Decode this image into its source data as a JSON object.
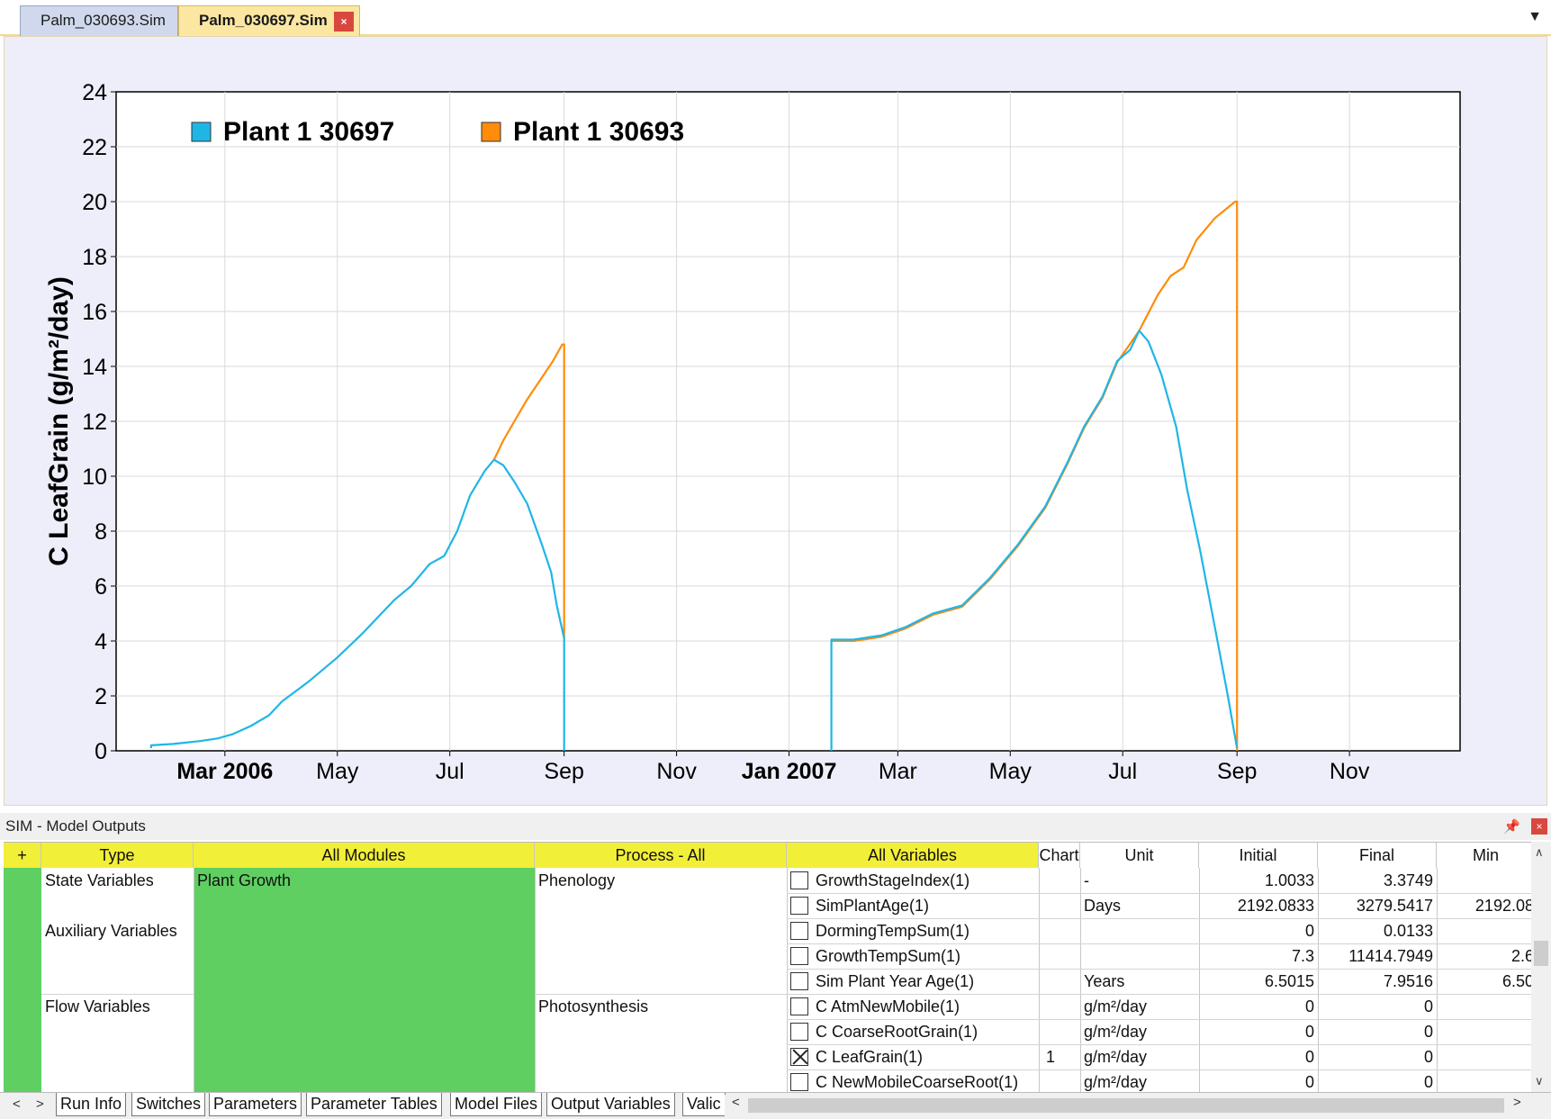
{
  "doc_tabs": {
    "inactive": "Palm_030693.Sim",
    "active": "Palm_030697.Sim",
    "close_glyph": "×",
    "dropdown_glyph": "▼"
  },
  "chart_data": {
    "type": "line",
    "ylabel": "C LeafGrain (g/m²/day)",
    "ylim": [
      0,
      24
    ],
    "yticks": [
      0,
      2,
      4,
      6,
      8,
      10,
      12,
      14,
      16,
      18,
      20,
      22,
      24
    ],
    "xticks": [
      {
        "label": "Mar 2006",
        "date": "2006-03-01",
        "bold": true
      },
      {
        "label": "May",
        "date": "2006-05-01",
        "bold": false
      },
      {
        "label": "Jul",
        "date": "2006-07-01",
        "bold": false
      },
      {
        "label": "Sep",
        "date": "2006-09-01",
        "bold": false
      },
      {
        "label": "Nov",
        "date": "2006-11-01",
        "bold": false
      },
      {
        "label": "Jan 2007",
        "date": "2007-01-01",
        "bold": true
      },
      {
        "label": "Mar",
        "date": "2007-03-01",
        "bold": false
      },
      {
        "label": "May",
        "date": "2007-05-01",
        "bold": false
      },
      {
        "label": "Jul",
        "date": "2007-07-01",
        "bold": false
      },
      {
        "label": "Sep",
        "date": "2007-09-01",
        "bold": false
      },
      {
        "label": "Nov",
        "date": "2007-11-01",
        "bold": false
      }
    ],
    "xlim": [
      "2006-01-01",
      "2007-12-31"
    ],
    "grid": true,
    "legend_placement": "top-left",
    "series": [
      {
        "name": "Plant 1 30697",
        "color": "#1fb6e6",
        "segments": [
          [
            [
              "2006-01-20",
              0.1
            ],
            [
              "2006-01-20",
              0.2
            ],
            [
              "2006-02-01",
              0.25
            ],
            [
              "2006-02-15",
              0.35
            ],
            [
              "2006-02-25",
              0.45
            ],
            [
              "2006-03-05",
              0.6
            ],
            [
              "2006-03-15",
              0.9
            ],
            [
              "2006-03-25",
              1.3
            ],
            [
              "2006-04-01",
              1.8
            ],
            [
              "2006-04-15",
              2.5
            ],
            [
              "2006-05-01",
              3.4
            ],
            [
              "2006-05-15",
              4.3
            ],
            [
              "2006-06-01",
              5.5
            ],
            [
              "2006-06-10",
              6.0
            ],
            [
              "2006-06-20",
              6.8
            ],
            [
              "2006-06-28",
              7.1
            ],
            [
              "2006-07-05",
              8.0
            ],
            [
              "2006-07-12",
              9.3
            ],
            [
              "2006-07-20",
              10.2
            ],
            [
              "2006-07-25",
              10.6
            ],
            [
              "2006-07-30",
              10.4
            ],
            [
              "2006-08-05",
              9.8
            ],
            [
              "2006-08-12",
              9.0
            ],
            [
              "2006-08-20",
              7.5
            ],
            [
              "2006-08-25",
              6.5
            ],
            [
              "2006-08-28",
              5.3
            ],
            [
              "2006-09-01",
              4.1
            ],
            [
              "2006-09-01",
              0.0
            ]
          ],
          [
            [
              "2007-01-24",
              0.0
            ],
            [
              "2007-01-24",
              4.05
            ],
            [
              "2007-02-05",
              4.05
            ],
            [
              "2007-02-20",
              4.2
            ],
            [
              "2007-03-05",
              4.5
            ],
            [
              "2007-03-20",
              5.0
            ],
            [
              "2007-04-05",
              5.3
            ],
            [
              "2007-04-20",
              6.3
            ],
            [
              "2007-05-05",
              7.5
            ],
            [
              "2007-05-20",
              8.9
            ],
            [
              "2007-06-01",
              10.5
            ],
            [
              "2007-06-10",
              11.8
            ],
            [
              "2007-06-20",
              12.9
            ],
            [
              "2007-06-28",
              14.2
            ],
            [
              "2007-07-05",
              14.6
            ],
            [
              "2007-07-10",
              15.3
            ],
            [
              "2007-07-15",
              14.9
            ],
            [
              "2007-07-22",
              13.7
            ],
            [
              "2007-07-30",
              11.8
            ],
            [
              "2007-08-05",
              9.5
            ],
            [
              "2007-08-12",
              7.3
            ],
            [
              "2007-08-20",
              4.5
            ],
            [
              "2007-08-27",
              2.0
            ],
            [
              "2007-09-01",
              0.1
            ]
          ]
        ]
      },
      {
        "name": "Plant 1 30693",
        "color": "#ff8c0a",
        "segments": [
          [
            [
              "2006-07-25",
              10.6
            ],
            [
              "2006-07-30",
              11.3
            ],
            [
              "2006-08-05",
              12.0
            ],
            [
              "2006-08-12",
              12.8
            ],
            [
              "2006-08-20",
              13.6
            ],
            [
              "2006-08-26",
              14.2
            ],
            [
              "2006-08-31",
              14.8
            ],
            [
              "2006-09-01",
              14.8
            ],
            [
              "2006-09-01",
              4.1
            ]
          ],
          [
            [
              "2007-01-24",
              4.0
            ],
            [
              "2007-02-05",
              4.0
            ],
            [
              "2007-02-20",
              4.15
            ],
            [
              "2007-03-05",
              4.45
            ],
            [
              "2007-03-20",
              4.95
            ],
            [
              "2007-04-05",
              5.25
            ],
            [
              "2007-04-20",
              6.25
            ],
            [
              "2007-05-05",
              7.45
            ],
            [
              "2007-05-20",
              8.85
            ],
            [
              "2007-06-01",
              10.45
            ],
            [
              "2007-06-10",
              11.75
            ],
            [
              "2007-06-20",
              12.85
            ],
            [
              "2007-06-28",
              14.15
            ],
            [
              "2007-07-10",
              15.3
            ],
            [
              "2007-07-20",
              16.6
            ],
            [
              "2007-07-27",
              17.3
            ],
            [
              "2007-08-03",
              17.6
            ],
            [
              "2007-08-10",
              18.6
            ],
            [
              "2007-08-20",
              19.4
            ],
            [
              "2007-08-31",
              20.0
            ],
            [
              "2007-09-01",
              20.0
            ],
            [
              "2007-09-01",
              0.0
            ]
          ]
        ]
      }
    ]
  },
  "outputs": {
    "title": "SIM - Model Outputs",
    "pin_glyph": "📌",
    "close_glyph": "×",
    "headers": {
      "plus": "+",
      "type": "Type",
      "modules": "All Modules",
      "process": "Process - All",
      "variables": "All Variables",
      "chart": "Chart",
      "unit": "Unit",
      "initial": "Initial",
      "final": "Final",
      "min": "Min"
    },
    "types": [
      "State Variables",
      "Auxiliary Variables",
      "Flow Variables"
    ],
    "module": "Plant Growth",
    "processes": [
      "Phenology",
      "Photosynthesis"
    ],
    "rows": [
      {
        "checked": false,
        "name": "GrowthStageIndex(1)",
        "chart": "",
        "unit": "-",
        "initial": "1.0033",
        "final": "3.3749",
        "min": ""
      },
      {
        "checked": false,
        "name": "SimPlantAge(1)",
        "chart": "",
        "unit": "Days",
        "initial": "2192.0833",
        "final": "3279.5417",
        "min": "2192.08"
      },
      {
        "checked": false,
        "name": "DormingTempSum(1)",
        "chart": "",
        "unit": "",
        "initial": "0",
        "final": "0.0133",
        "min": ""
      },
      {
        "checked": false,
        "name": "GrowthTempSum(1)",
        "chart": "",
        "unit": "",
        "initial": "7.3",
        "final": "11414.7949",
        "min": "2.6"
      },
      {
        "checked": false,
        "name": "Sim Plant Year Age(1)",
        "chart": "",
        "unit": "Years",
        "initial": "6.5015",
        "final": "7.9516",
        "min": "6.50"
      },
      {
        "checked": false,
        "name": "C AtmNewMobile(1)",
        "chart": "",
        "unit": "g/m²/day",
        "initial": "0",
        "final": "0",
        "min": ""
      },
      {
        "checked": false,
        "name": "C CoarseRootGrain(1)",
        "chart": "",
        "unit": "g/m²/day",
        "initial": "0",
        "final": "0",
        "min": ""
      },
      {
        "checked": true,
        "name": "C LeafGrain(1)",
        "chart": "1",
        "unit": "g/m²/day",
        "initial": "0",
        "final": "0",
        "min": ""
      },
      {
        "checked": false,
        "name": "C NewMobileCoarseRoot(1)",
        "chart": "",
        "unit": "g/m²/day",
        "initial": "0",
        "final": "0",
        "min": ""
      }
    ]
  },
  "bottom_tabs": {
    "left_arrow": "<",
    "right_arrow": ">",
    "items": [
      "Run Info",
      "Switches",
      "Parameters",
      "Parameter Tables",
      "Model Files",
      "Output Variables",
      "Valic"
    ],
    "scroll_left": "<",
    "scroll_right": ">"
  },
  "colors": {
    "yellow_header": "#f2ef38",
    "green_module": "#5fcf62",
    "chart_bg": "#eeeefa"
  }
}
